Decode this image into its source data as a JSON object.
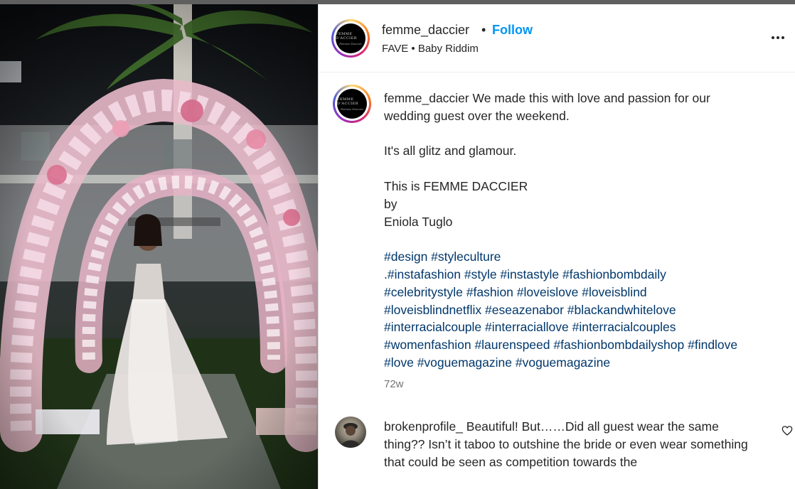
{
  "post": {
    "author": "femme_daccier",
    "separator": "•",
    "follow_label": "Follow",
    "audio": "FAVE • Baby Riddim",
    "avatar_logo": "FEMME D'ACCIER",
    "avatar_sub": "Femme Daccier",
    "more_icon": "more-horizontal-icon"
  },
  "caption": {
    "author": "femme_daccier",
    "lines": [
      "We made this with love and passion for our",
      "wedding guest over the weekend.",
      "",
      "It's all glitz and glamour.",
      "",
      "This is FEMME DACCIER",
      "by",
      "Eniola Tuglo",
      ""
    ],
    "hashtag_lines": [
      "#design #styleculture",
      ".#instafashion #style #instastyle #fashionbombdaily",
      "#celebritystyle #fashion #loveislove #loveisblind",
      "#loveisblindnetflix #eseazenabor #blackandwhitelove",
      "#interracialcouple #interraciallove #interracialcouples",
      "#womenfashion #laurenspeed #fashionbombdailyshop #findlove",
      "#love #voguemagazine #voguemagazine"
    ],
    "time_ago": "72w"
  },
  "comment": {
    "author": "brokenprofile_",
    "lines": [
      "Beautiful! But……Did all guest wear the same",
      "thing?? Isn’t it taboo to outshine the bride or even wear",
      "something that could be seen as competition towards the"
    ],
    "like_icon": "heart-icon"
  },
  "colors": {
    "link_blue": "#0095f6",
    "hashtag": "#00376b",
    "muted": "#737373",
    "text": "#262626"
  }
}
